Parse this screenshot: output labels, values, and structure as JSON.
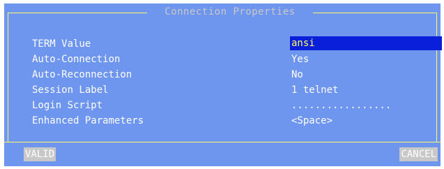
{
  "dialog": {
    "title": "Connection Properties",
    "fields": [
      {
        "label": "TERM Value",
        "value": "ansi"
      },
      {
        "label": "Auto-Connection",
        "value": "Yes"
      },
      {
        "label": "Auto-Reconnection",
        "value": "No"
      },
      {
        "label": "Session Label",
        "value": "1 telnet"
      },
      {
        "label": "Login Script",
        "value": "................."
      },
      {
        "label": "Enhanced Parameters",
        "value": "<Space>"
      }
    ],
    "buttons": {
      "valid": "VALID",
      "cancel": "CANCEL"
    }
  },
  "colors": {
    "dialog_background": "#6f96ee",
    "frame": "#ffff66",
    "selected_background": "#0a1fd9",
    "selected_text": "#ffff66",
    "button_background": "#c8c8c8"
  }
}
